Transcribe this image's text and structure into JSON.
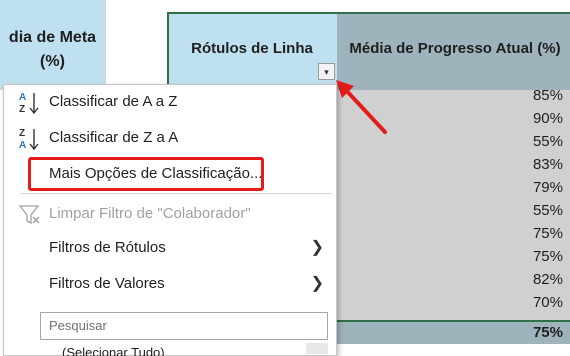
{
  "sheet": {
    "left_header": "dia de Meta\n(%)",
    "rotulos_header": "Rótulos de Linha",
    "media_header": "Média de Progresso Atual (%)",
    "filter_button": "▾",
    "values": [
      "85%",
      "90%",
      "55%",
      "83%",
      "79%",
      "55%",
      "75%",
      "75%",
      "82%",
      "70%"
    ],
    "total": "75%"
  },
  "menu": {
    "sort_az": "Classificar de A a Z",
    "sort_za": "Classificar de Z a A",
    "more_sort": "Mais Opções de Classificação...",
    "clear_filter": "Limpar Filtro de \"Colaborador\"",
    "label_filters": "Filtros de Rótulos",
    "value_filters": "Filtros de Valores",
    "search_placeholder": "Pesquisar",
    "select_all": "(Selecionar Tudo)"
  },
  "colors": {
    "header_blue": "#bfe0f0",
    "header_gray": "#9fb3bd",
    "highlight_red": "#e41b1b",
    "arrow_red": "#e41b1b"
  },
  "icons": {
    "sort_az": "sort-az-icon",
    "sort_za": "sort-za-icon",
    "clear_filter": "clear-filter-icon",
    "submenu": "chevron-right-icon"
  }
}
